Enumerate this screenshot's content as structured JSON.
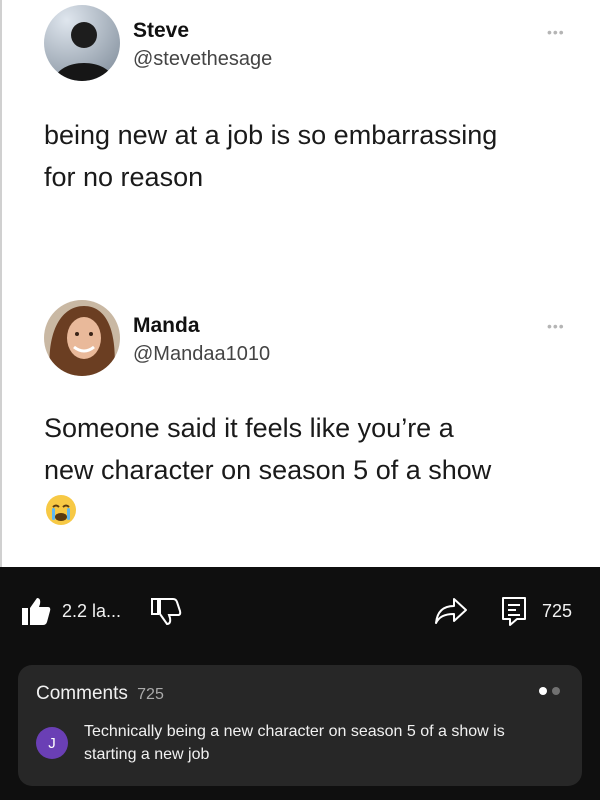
{
  "post": {
    "tweets": [
      {
        "name": "Steve",
        "handle": "@stevethesage",
        "text_line1": "being new at a job is so embarrassing",
        "text_line2": "for no reason",
        "avatar_icon": "profile-photo-dark"
      },
      {
        "name": "Manda",
        "handle": "@Mandaa1010",
        "text_line1": "Someone said it feels like you’re a",
        "text_line2": "new character on season 5 of a show",
        "emoji": "crying-face-icon",
        "avatar_icon": "profile-photo-woman"
      }
    ]
  },
  "actions": {
    "like_label": "2.2 la...",
    "comments_label": "725",
    "like_icon": "thumbs-up-icon",
    "dislike_icon": "thumbs-down-icon",
    "share_icon": "share-icon",
    "comment_icon": "comment-icon"
  },
  "comments": {
    "title": "Comments",
    "count": "725",
    "top_comment": {
      "avatar_letter": "J",
      "text": "Technically being a new character on season 5 of a show is starting a new job"
    },
    "accent_active_dot": "#ffffff",
    "accent_inactive_dot": "#717171"
  }
}
